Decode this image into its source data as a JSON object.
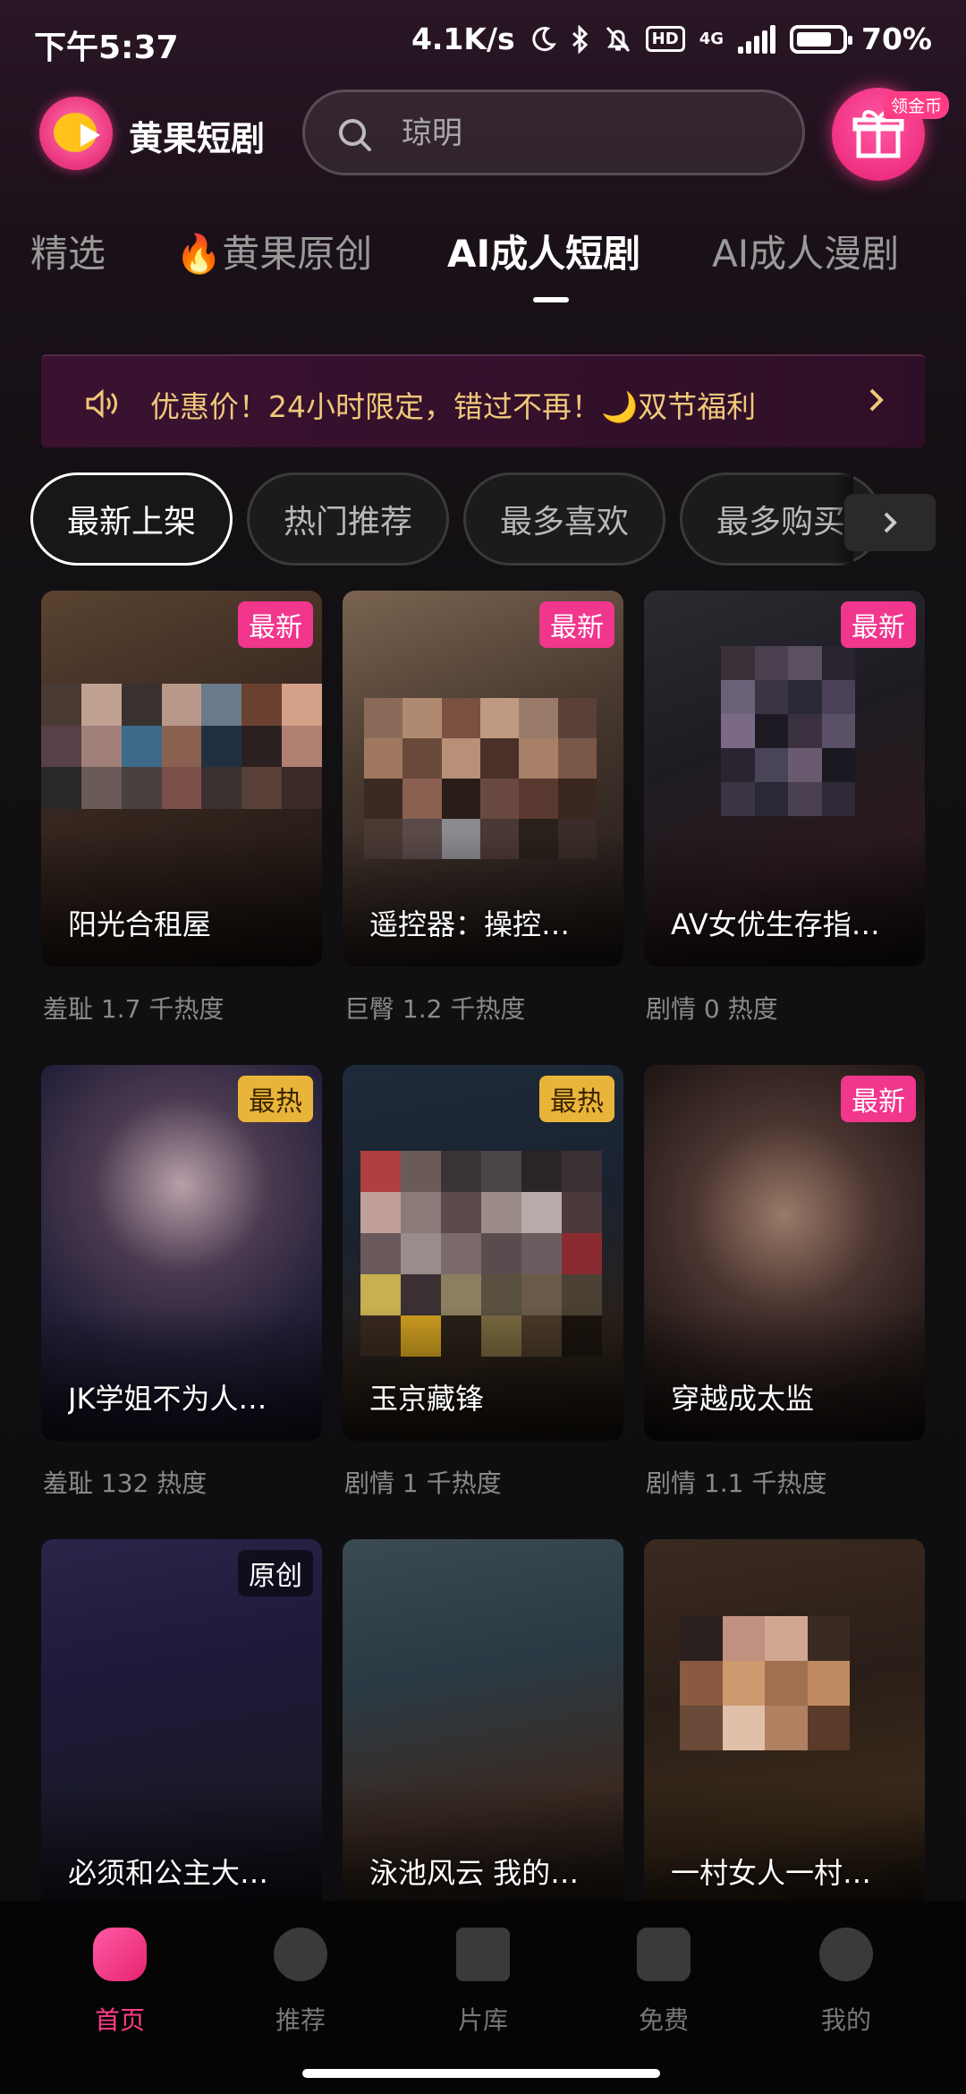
{
  "status_bar": {
    "time": "下午5:37",
    "net_speed": "4.1K/s",
    "hd": "HD",
    "network": "4G",
    "battery": "70%"
  },
  "header": {
    "app_name": "黄果短剧",
    "search_placeholder": "琼明",
    "gift_badge": "领金币"
  },
  "tabs": [
    {
      "label": "精选",
      "active": false
    },
    {
      "label": "🔥黄果原创",
      "active": false
    },
    {
      "label": "AI成人短剧",
      "active": true
    },
    {
      "label": "AI成人漫剧",
      "active": false
    }
  ],
  "banner": {
    "text": "优惠价！24小时限定，错过不再！🌙双节福利"
  },
  "filters": [
    {
      "label": "最新上架",
      "active": true
    },
    {
      "label": "热门推荐",
      "active": false
    },
    {
      "label": "最多喜欢",
      "active": false
    },
    {
      "label": "最多购买",
      "active": false
    }
  ],
  "dramas": [
    {
      "title": "阳光合租屋",
      "tag": "最新",
      "tag_type": "new",
      "meta": "羞耻 1.7 千热度"
    },
    {
      "title": "遥控器：操控…",
      "tag": "最新",
      "tag_type": "new",
      "meta": "巨臀 1.2 千热度"
    },
    {
      "title": "AV女优生存指…",
      "tag": "最新",
      "tag_type": "new",
      "meta": "剧情 0 热度"
    },
    {
      "title": "JK学姐不为人…",
      "tag": "最热",
      "tag_type": "hot",
      "meta": "羞耻 132 热度"
    },
    {
      "title": "玉京藏锋",
      "tag": "最热",
      "tag_type": "hot",
      "meta": "剧情 1 千热度"
    },
    {
      "title": "穿越成太监",
      "tag": "最新",
      "tag_type": "new",
      "meta": "剧情 1.1 千热度"
    },
    {
      "title": "必须和公主大…",
      "tag": "原创",
      "tag_type": "orig",
      "meta": ""
    },
    {
      "title": "泳池风云 我的…",
      "tag": "",
      "tag_type": "",
      "meta": ""
    },
    {
      "title": "一村女人一村…",
      "tag": "",
      "tag_type": "",
      "meta": ""
    }
  ],
  "bottom_nav": [
    {
      "label": "首页",
      "icon": "home-icon",
      "active": true
    },
    {
      "label": "推荐",
      "icon": "star-icon",
      "active": false
    },
    {
      "label": "片库",
      "icon": "clapperboard-icon",
      "active": false
    },
    {
      "label": "免费",
      "icon": "tag-icon",
      "active": false
    },
    {
      "label": "我的",
      "icon": "profile-icon",
      "active": false
    }
  ],
  "colors": {
    "accent": "#ff3d86",
    "banner_text": "#f0c87a",
    "tag_new": "#f0368d",
    "tag_hot": "#e9b43a"
  }
}
